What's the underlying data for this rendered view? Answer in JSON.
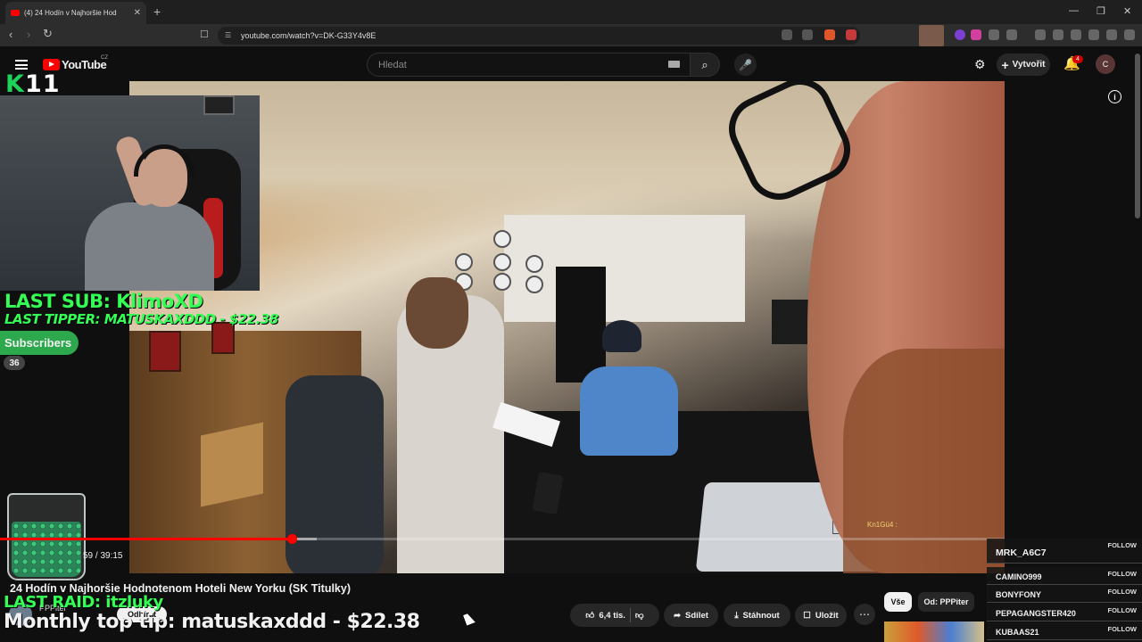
{
  "browser": {
    "tab_title": "(4) 24 Hodín v Najhoršie Hod",
    "tab_close": "✕",
    "new_tab": "+",
    "url": "youtube.com/watch?v=DK-G33Y4v8E",
    "window_controls": [
      "—",
      "❐",
      "✕"
    ]
  },
  "youtube": {
    "logo_text": "YouTube",
    "region": "CZ",
    "search_placeholder": "Hledat",
    "create_label": "Vytvořit",
    "notification_count": "4",
    "avatar_letter": "C"
  },
  "overlay": {
    "k11_k": "K",
    "k11_num": "11",
    "last_sub": "LAST SUB: KlimoXD",
    "last_tipper": "LAST TIPPER: MATUSKAXDDD - $22.38",
    "subscribers_label": "Subscribers",
    "subscribers_count": "36",
    "last_raid": "LAST RAID: itzluky",
    "monthly_top_tip": "Monthly top tip: matuskaxddd - $22.38"
  },
  "player": {
    "time": "59 / 39:15",
    "progress": 0.29,
    "buffered": 0.315,
    "chat_overlay_name": "Kn1Gü4 :"
  },
  "video": {
    "title": "24 Hodín v Najhoršie Hodnotenom Hoteli New Yorku (SK Titulky)",
    "channel": "PPPiter",
    "subscribe_label": "Odbírat",
    "likes": "6,4 tis.",
    "share_label": "Sdílet",
    "download_label": "Stáhnout",
    "save_label": "Uložit",
    "more_label": "⋯"
  },
  "recommend_chips": [
    "Vše",
    "Od: PPPiter"
  ],
  "follow_list": {
    "follow_label": "FOLLOW",
    "users": [
      "MRK_A6C7",
      "CAMINO999",
      "BONYFONY",
      "PEPAGANGSTER420",
      "KUBAAS21"
    ]
  },
  "colors": {
    "accent_red": "#ff0000",
    "overlay_green": "#33ff55",
    "subscribers_green": "#2ea84c"
  }
}
